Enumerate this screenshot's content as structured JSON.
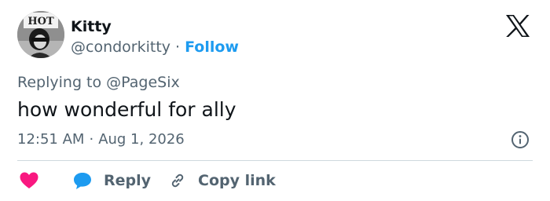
{
  "user": {
    "name": "Kitty",
    "handle": "@condorkitty",
    "separator": "·",
    "follow_label": "Follow",
    "avatar_sign_text": "HOT"
  },
  "reply_context": {
    "prefix": "Replying to",
    "mention": "@PageSix"
  },
  "tweet": {
    "text": "how wonderful for ally",
    "time": "12:51 AM",
    "separator": "·",
    "date": "Aug 1, 2026"
  },
  "actions": {
    "reply_label": "Reply",
    "copy_link_label": "Copy link"
  },
  "icons": {
    "brand": "x-logo-icon",
    "info": "info-icon",
    "like": "heart-icon",
    "reply": "speech-bubble-icon",
    "copy": "link-icon"
  },
  "colors": {
    "accent": "#1d9bf0",
    "like": "#f91880",
    "text": "#0f1419",
    "secondary": "#536471",
    "divider": "#cfd9de"
  }
}
